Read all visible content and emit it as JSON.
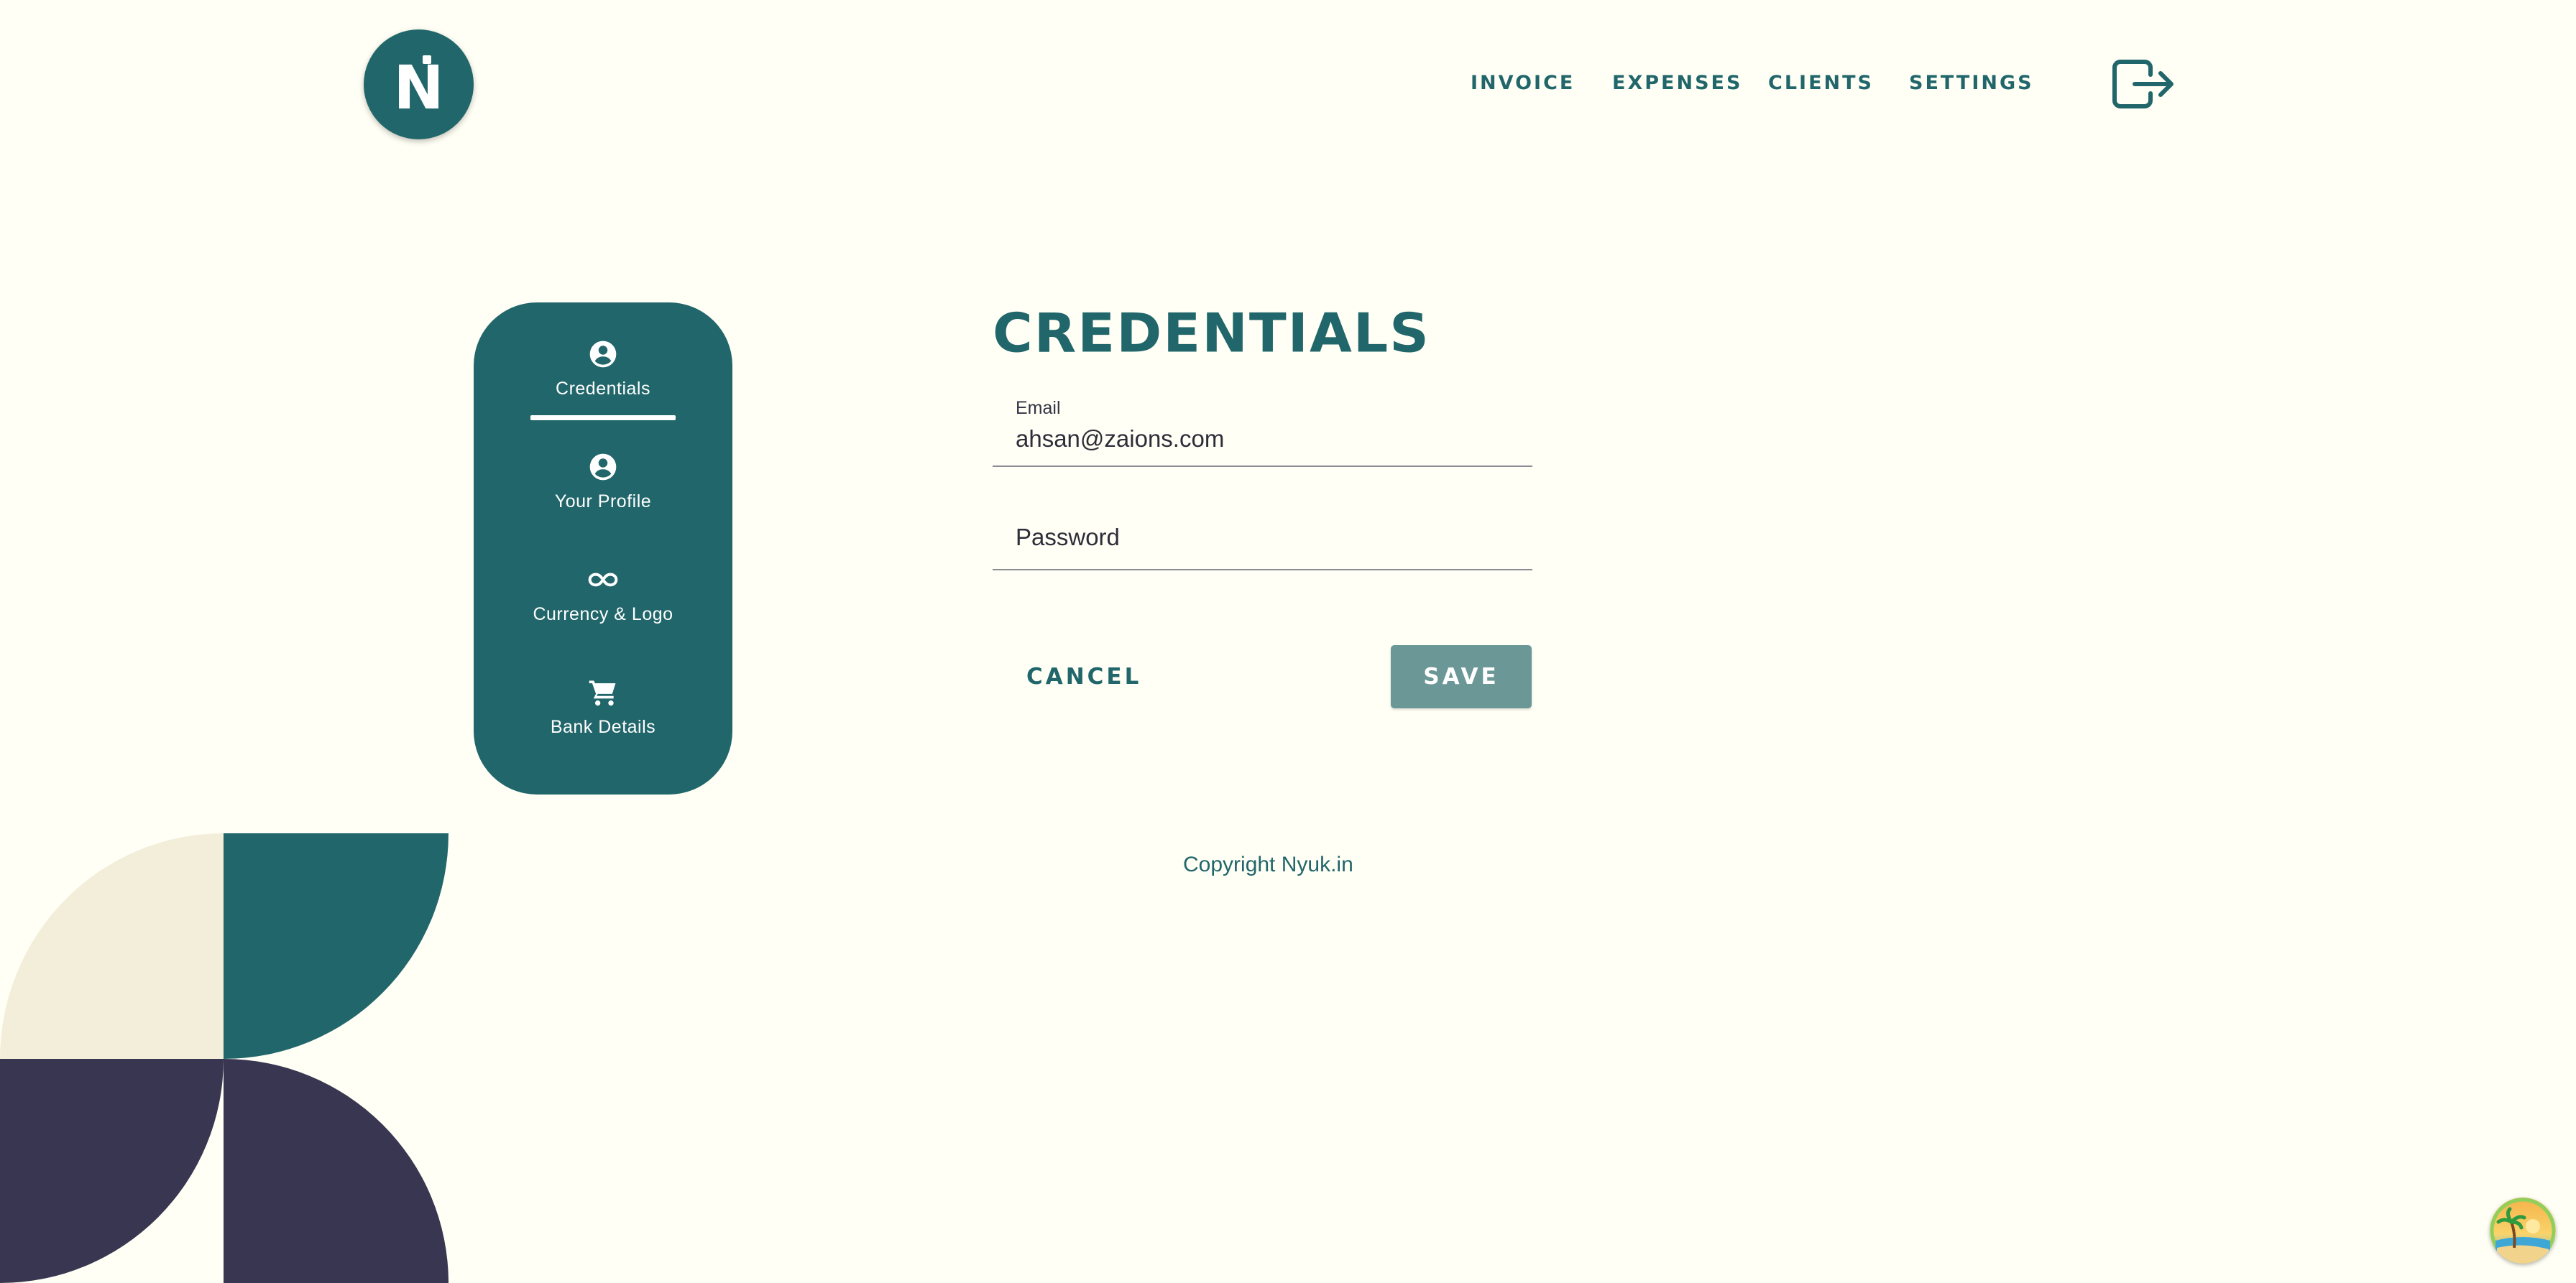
{
  "header": {
    "logo_text": "N",
    "nav": [
      {
        "label": "INVOICE"
      },
      {
        "label": "EXPENSES"
      },
      {
        "label": "CLIENTS"
      },
      {
        "label": "SETTINGS"
      }
    ],
    "logout_icon": "logout-icon"
  },
  "sidebar": {
    "items": [
      {
        "label": "Credentials",
        "icon": "account-circle-icon",
        "active": true
      },
      {
        "label": "Your Profile",
        "icon": "account-circle-icon",
        "active": false
      },
      {
        "label": "Currency & Logo",
        "icon": "infinity-icon",
        "active": false
      },
      {
        "label": "Bank Details",
        "icon": "cart-icon",
        "active": false
      }
    ]
  },
  "form": {
    "title": "CREDENTIALS",
    "email": {
      "label": "Email",
      "value": "ahsan@zaions.com"
    },
    "password": {
      "placeholder": "Password",
      "value": ""
    },
    "cancel_label": "CANCEL",
    "save_label": "SAVE"
  },
  "footer": {
    "copyright": "Copyright Nyuk.in"
  },
  "colors": {
    "background": "#fffff5",
    "primary": "#21666a",
    "dark": "#383650",
    "cream": "#f3eeda",
    "save_disabled": "#6b9796"
  }
}
